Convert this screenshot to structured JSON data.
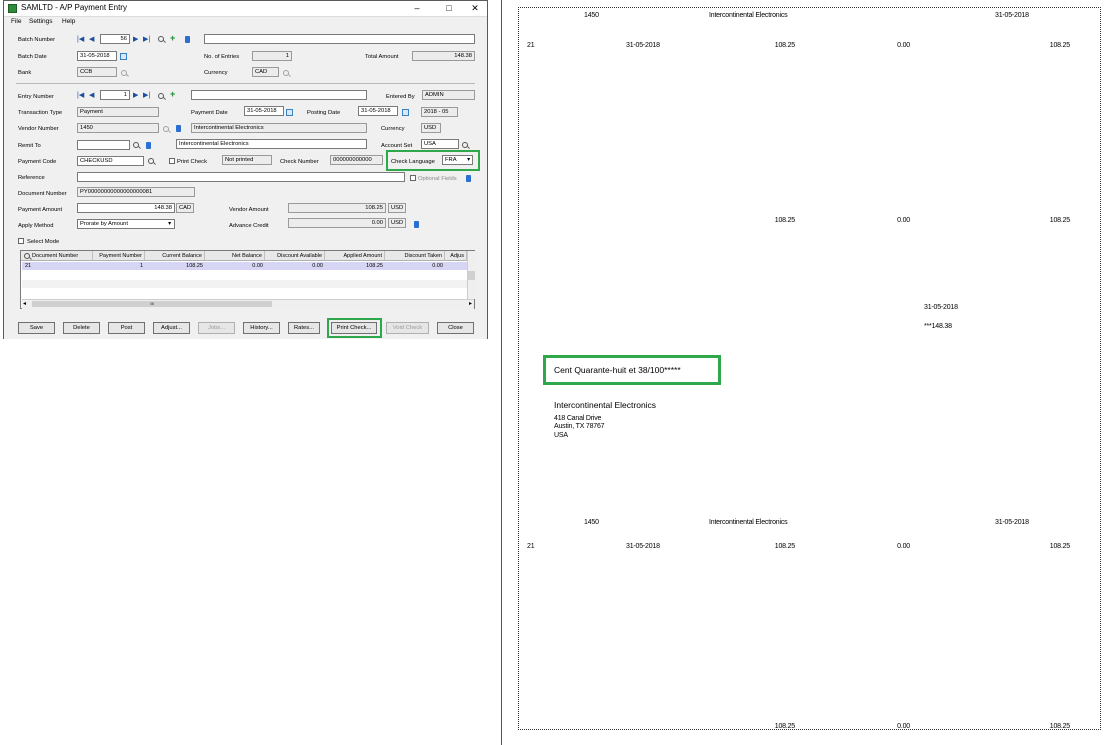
{
  "window": {
    "title": "SAMLTD - A/P Payment Entry",
    "controls": {
      "minimize": "–",
      "maximize": "□",
      "close": "✕"
    },
    "menu": [
      "File",
      "Settings",
      "Help"
    ]
  },
  "form": {
    "batch_number_label": "Batch Number",
    "batch_number": "56",
    "batch_desc": "",
    "batch_date_label": "Batch Date",
    "batch_date": "31-05-2018",
    "no_entries_label": "No. of Entries",
    "no_entries": "1",
    "total_amount_label": "Total Amount",
    "total_amount": "148.38",
    "bank_label": "Bank",
    "bank": "CCB",
    "batch_currency_label": "Currency",
    "batch_currency": "CAD",
    "entry_number_label": "Entry Number",
    "entry_number": "1",
    "entry_desc": "",
    "entered_by_label": "Entered By",
    "entered_by": "ADMIN",
    "transaction_type_label": "Transaction Type",
    "transaction_type": "Payment",
    "payment_date_label": "Payment Date",
    "payment_date": "31-05-2018",
    "posting_date_label": "Posting Date",
    "posting_date": "31-05-2018",
    "period": "2018 - 05",
    "vendor_number_label": "Vendor Number",
    "vendor_number": "1450",
    "vendor_name": "Intercontinental Electronics",
    "vendor_currency_label": "Currency",
    "vendor_currency": "USD",
    "remit_to_label": "Remit To",
    "remit_to": "",
    "remit_name": "Intercontinental Electronics",
    "account_set_label": "Account Set",
    "account_set": "USA",
    "payment_code_label": "Payment Code",
    "payment_code": "CHECKUSD",
    "print_check_label": "Print Check",
    "print_status": "Not printed",
    "check_number_label": "Check Number",
    "check_number": "000000000000",
    "check_language_label": "Check Language",
    "check_language": "FRA",
    "reference_label": "Reference",
    "reference": "",
    "optional_fields_label": "Optional Fields",
    "document_number_label": "Document Number",
    "document_number": "PY00000000000000000081",
    "payment_amount_label": "Payment Amount",
    "payment_amount": "148.38",
    "payment_currency": "CAD",
    "vendor_amount_label": "Vendor Amount",
    "vendor_amount": "108.25",
    "vendor_amount_currency": "USD",
    "apply_method_label": "Apply Method",
    "apply_method": "Prorate by Amount",
    "advance_credit_label": "Advance Credit",
    "advance_credit": "0.00",
    "advance_currency": "USD",
    "select_mode_label": "Select Mode"
  },
  "grid": {
    "columns": [
      "Document Number",
      "Payment Number",
      "Current Balance",
      "Net Balance",
      "Discount Available",
      "Applied Amount",
      "Discount Taken",
      "Adjus"
    ],
    "rows": [
      [
        "21",
        "1",
        "108.25",
        "0.00",
        "0.00",
        "108.25",
        "0.00",
        ""
      ]
    ],
    "scroll_glyph": "III"
  },
  "buttons": {
    "save": "Save",
    "delete": "Delete",
    "post": "Post",
    "adjust": "Adjust...",
    "jobs": "Jobs...",
    "history": "History...",
    "rates": "Rates...",
    "print_check": "Print Check...",
    "void_check": "Void Check",
    "close": "Close"
  },
  "check": {
    "stub1": {
      "vendor": "1450",
      "name": "Intercontinental Electronics",
      "date": "31-05-2018",
      "doc": "21",
      "doc_date": "31-05-2018",
      "amount": "108.25",
      "discount": "0.00",
      "net": "108.25",
      "total_amount": "108.25",
      "total_discount": "0.00",
      "total_net": "108.25"
    },
    "check_date": "31-05-2018",
    "check_amount": "***148.38",
    "amount_words": "Cent Quarante-huit et 38/100*****",
    "payee_name": "Intercontinental Electronics",
    "payee_address": [
      "418 Canal Drive",
      "Austin, TX 78767",
      "USA"
    ],
    "stub2": {
      "vendor": "1450",
      "name": "Intercontinental Electronics",
      "date": "31-05-2018",
      "doc": "21",
      "doc_date": "31-05-2018",
      "amount": "108.25",
      "discount": "0.00",
      "net": "108.25",
      "total_amount": "108.25",
      "total_discount": "0.00",
      "total_net": "108.25"
    }
  },
  "accent_colors": {
    "highlight": "#2ea84a",
    "nav_blue": "#1a4fa0",
    "grid_selection": "#d6d6f4"
  }
}
